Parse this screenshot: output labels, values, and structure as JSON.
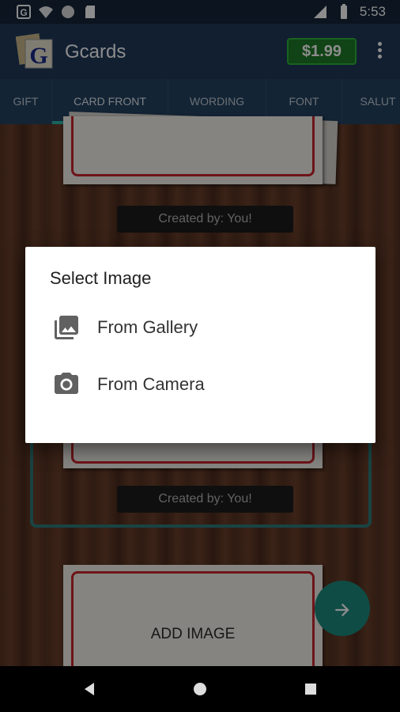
{
  "status_bar": {
    "time": "5:53",
    "icons": [
      "g-notification-icon",
      "wifi-icon",
      "circle-icon",
      "sd-card-icon",
      "lte-signal-icon",
      "battery-icon"
    ]
  },
  "app_bar": {
    "title": "Gcards",
    "price": "$1.99",
    "logo": "G"
  },
  "tabs": [
    {
      "label": "GIFT",
      "active": false
    },
    {
      "label": "CARD FRONT",
      "active": true
    },
    {
      "label": "WORDING",
      "active": false
    },
    {
      "label": "FONT",
      "active": false
    },
    {
      "label": "SALUT",
      "active": false
    }
  ],
  "content": {
    "created_by_1": "Created by: You!",
    "created_by_2": "Created by: You!",
    "add_image": "ADD IMAGE",
    "fab_icon": "arrow-right-icon"
  },
  "dialog": {
    "title": "Select Image",
    "options": [
      {
        "label": "From Gallery",
        "icon": "gallery-icon"
      },
      {
        "label": "From Camera",
        "icon": "camera-icon"
      }
    ]
  },
  "colors": {
    "app_bar": "#1f3a59",
    "tab_indicator": "#2db4a8",
    "price_bg": "#1e7a27",
    "card_border": "#c8262c",
    "fab": "#1d8a7f"
  }
}
